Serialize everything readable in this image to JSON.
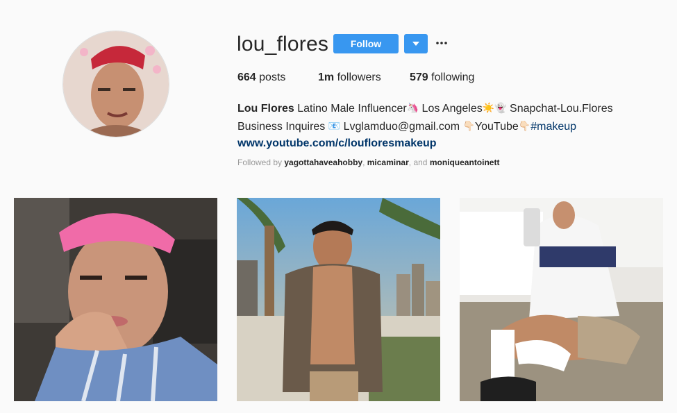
{
  "profile": {
    "username": "lou_flores",
    "follow_label": "Follow",
    "more_label": "•••",
    "stats": {
      "posts_count": "664",
      "posts_label": "posts",
      "followers_count": "1m",
      "followers_label": "followers",
      "following_count": "579",
      "following_label": "following"
    },
    "bio": {
      "name": "Lou Flores",
      "line1_a": "Latino Male Influencer",
      "line1_emoji1": "🦄",
      "line1_b": " Los Angeles",
      "line1_emoji2": "☀️",
      "line1_emoji3": "👻",
      "line1_c": " Snapchat-Lou.Flores",
      "line2_a": "Business Inquires ",
      "line2_emoji1": "📧",
      "line2_b": " Lvglamduo@gmail.com ",
      "line2_emoji2": "👇🏻",
      "line2_c": "YouTube",
      "line2_emoji3": "👇🏻",
      "hashtag": "#makeup",
      "website": "www.youtube.com/c/loufloresmakeup"
    },
    "followed_by": {
      "prefix": "Followed by ",
      "user1": "yagottahaveahobby",
      "sep1": ", ",
      "user2": "micaminar",
      "sep2": ", and ",
      "user3": "moniqueantoinett"
    }
  },
  "colors": {
    "accent": "#3897f0",
    "link": "#003569",
    "background": "#fafafa"
  },
  "icons": {
    "dropdown": "chevron-down-icon",
    "more": "more-options-icon"
  },
  "posts": [
    {
      "alt": "post-1"
    },
    {
      "alt": "post-2"
    },
    {
      "alt": "post-3"
    }
  ]
}
